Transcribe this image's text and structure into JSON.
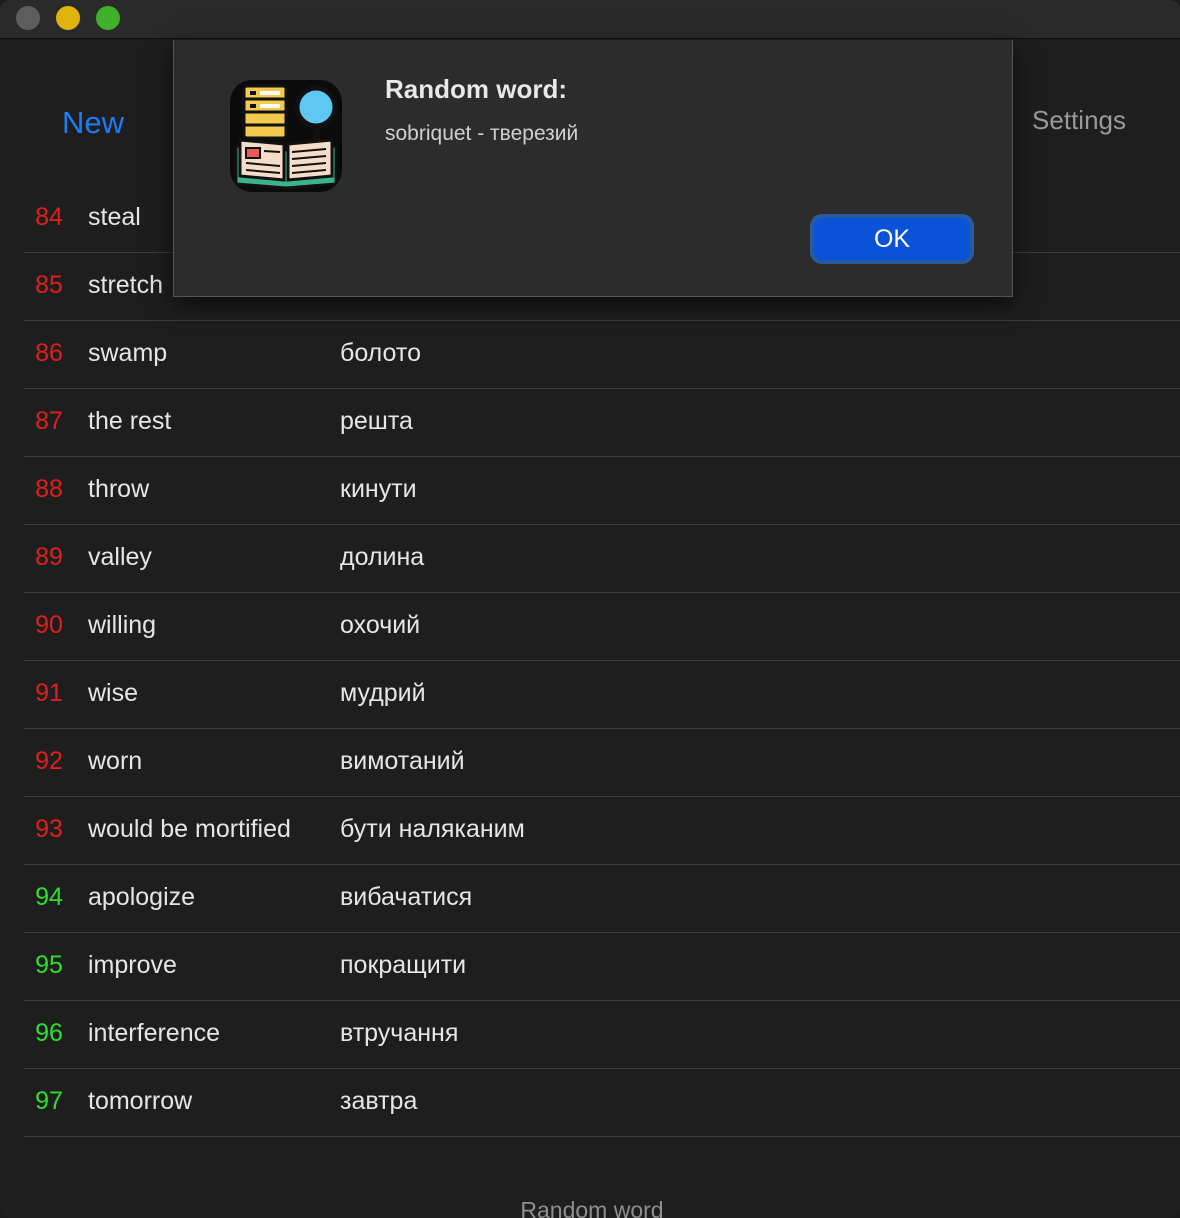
{
  "nav": {
    "new_label": "New",
    "settings_label": "Settings"
  },
  "words": [
    {
      "num": "84",
      "word": "steal",
      "translation": "",
      "status": "red"
    },
    {
      "num": "85",
      "word": "stretch",
      "translation": "",
      "status": "red"
    },
    {
      "num": "86",
      "word": "swamp",
      "translation": "болото",
      "status": "red"
    },
    {
      "num": "87",
      "word": "the rest",
      "translation": "решта",
      "status": "red"
    },
    {
      "num": "88",
      "word": "throw",
      "translation": "кинути",
      "status": "red"
    },
    {
      "num": "89",
      "word": "valley",
      "translation": "долина",
      "status": "red"
    },
    {
      "num": "90",
      "word": "willing",
      "translation": "охочий",
      "status": "red"
    },
    {
      "num": "91",
      "word": "wise",
      "translation": "мудрий",
      "status": "red"
    },
    {
      "num": "92",
      "word": "worn",
      "translation": "вимотаний",
      "status": "red"
    },
    {
      "num": "93",
      "word": "would be mortified",
      "translation": "бути наляканим",
      "status": "red"
    },
    {
      "num": "94",
      "word": "apologize",
      "translation": "вибачатися",
      "status": "green"
    },
    {
      "num": "95",
      "word": "improve",
      "translation": "покращити",
      "status": "green"
    },
    {
      "num": "96",
      "word": "interference",
      "translation": "втручання",
      "status": "green"
    },
    {
      "num": "97",
      "word": "tomorrow",
      "translation": "завтра",
      "status": "green"
    }
  ],
  "footer": {
    "random_word_label": "Random word"
  },
  "alert": {
    "title": "Random word:",
    "message": "sobriquet - тверезий",
    "ok_label": "OK"
  },
  "colors": {
    "accent": "#1e7bf3",
    "red_status": "#e01f1f",
    "green_status": "#2ee02e",
    "ok_button": "#0a53d8"
  }
}
